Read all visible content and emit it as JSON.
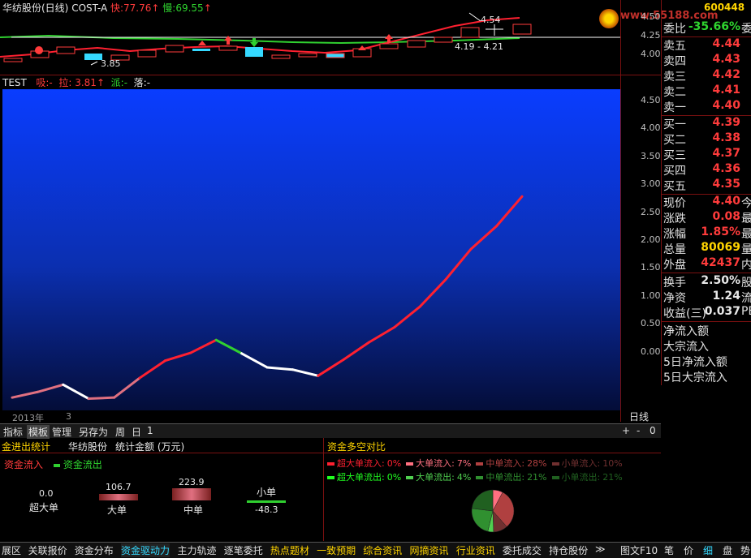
{
  "kline": {
    "stock_name": "华纺股份(日线)",
    "indicator": "COST-A",
    "fast_label": "快:",
    "fast_value": "77.76",
    "slow_label": "慢:",
    "slow_value": "69.55",
    "arrow": "↑",
    "ann_high": "4.54",
    "ann_low": "3.85",
    "ann_range": "4.19 - 4.21",
    "watermark": "www.55188.com",
    "axis_labels": [
      "4.50",
      "4.25",
      "4.00"
    ]
  },
  "test_bar": {
    "name": "TEST",
    "xi_label": "吸:",
    "xi_value": "-",
    "la_label": "拉:",
    "la_value": "3.81",
    "pai_label": "派:",
    "pai_value": "-",
    "luo_label": "落:",
    "luo_value": "-"
  },
  "chart_data": {
    "type": "line",
    "x": [
      0,
      1,
      2,
      3,
      4,
      5,
      6,
      7,
      8,
      9,
      10,
      11,
      12,
      13,
      14,
      15,
      16,
      17,
      18,
      19,
      20
    ],
    "values": [
      -0.82,
      -0.72,
      -0.59,
      -0.84,
      -0.82,
      -0.47,
      -0.16,
      -0.02,
      0.21,
      -0.03,
      -0.28,
      -0.32,
      -0.43,
      -0.14,
      0.17,
      0.44,
      0.81,
      1.29,
      1.84,
      2.25,
      2.78
    ],
    "colors": [
      "#e07080",
      "#e07080",
      "#ffffff",
      "#e07080",
      "#e07080",
      "#ff2030",
      "#ff2030",
      "#ff2030",
      "#30d030",
      "#ffffff",
      "#ffffff",
      "#ffffff",
      "#ff2030",
      "#ff2030",
      "#ff2030",
      "#ff2030",
      "#ff2030",
      "#ff2030",
      "#ff2030",
      "#ff2030"
    ],
    "ylim": [
      -1.05,
      4.7
    ],
    "yticks": [
      "4.50",
      "4.00",
      "3.50",
      "3.00",
      "2.50",
      "2.00",
      "1.50",
      "1.00",
      "0.50",
      "0.00"
    ],
    "xlabels": [
      "2013年",
      "3"
    ],
    "period": "日线"
  },
  "quote": {
    "code": "600448",
    "wei_bi_label": "委比",
    "wei_bi": "-35.66%",
    "wei_bi_ext": "委",
    "sells": [
      {
        "label": "卖五",
        "price": "4.44"
      },
      {
        "label": "卖四",
        "price": "4.43"
      },
      {
        "label": "卖三",
        "price": "4.42"
      },
      {
        "label": "卖二",
        "price": "4.41"
      },
      {
        "label": "卖一",
        "price": "4.40"
      }
    ],
    "buys": [
      {
        "label": "买一",
        "price": "4.39"
      },
      {
        "label": "买二",
        "price": "4.38"
      },
      {
        "label": "买三",
        "price": "4.37"
      },
      {
        "label": "买四",
        "price": "4.36"
      },
      {
        "label": "买五",
        "price": "4.35"
      }
    ],
    "stats": [
      {
        "label": "现价",
        "value": "4.40",
        "ext": "今",
        "color": "#ff3b3b"
      },
      {
        "label": "涨跌",
        "value": "0.08",
        "ext": "最",
        "color": "#ff3b3b"
      },
      {
        "label": "涨幅",
        "value": "1.85%",
        "ext": "最",
        "color": "#ff3b3b"
      },
      {
        "label": "总量",
        "value": "80069",
        "ext": "量",
        "color": "#ffd400"
      },
      {
        "label": "外盘",
        "value": "42437",
        "ext": "内",
        "color": "#ff3b3b"
      }
    ],
    "stats2": [
      {
        "label": "换手",
        "value": "2.50%",
        "ext": "股"
      },
      {
        "label": "净资",
        "value": "1.24",
        "ext": "流"
      },
      {
        "label": "收益(三)",
        "value": "0.037",
        "ext": "PE"
      }
    ],
    "flows": [
      "净流入额",
      "大宗流入",
      "5日净流入额",
      "5日大宗流入"
    ]
  },
  "tabs": [
    "指标",
    "模板",
    "管理",
    "另存为",
    "周",
    "日",
    "1"
  ],
  "zoom": {
    "plus": "+",
    "minus": "-",
    "zero": "0"
  },
  "bottom_left": {
    "title": "金进出统计",
    "stock": "华纺股份",
    "stat_title": "统计金额 (万元)",
    "legend_in": "资金流入",
    "legend_out": "资金流出",
    "bars": [
      {
        "label": "超大单",
        "in": "0.0",
        "out": ""
      },
      {
        "label": "大单",
        "in": "106.7",
        "out": ""
      },
      {
        "label": "中单",
        "in": "223.9",
        "out": ""
      },
      {
        "label": "小单",
        "in": "",
        "out": "-48.3"
      }
    ]
  },
  "bottom_right": {
    "title": "资金多空对比",
    "row1": [
      {
        "label": "超大单流入:",
        "pct": "0%",
        "color": "#ff2030"
      },
      {
        "label": "大单流入:",
        "pct": "7%",
        "color": "#ff7080"
      },
      {
        "label": "中单流入:",
        "pct": "28%",
        "color": "#b04040"
      },
      {
        "label": "小单流入:",
        "pct": "10%",
        "color": "#703030"
      }
    ],
    "row2": [
      {
        "label": "超大单流出:",
        "pct": "0%",
        "color": "#20ff20"
      },
      {
        "label": "大单流出:",
        "pct": "4%",
        "color": "#50d050"
      },
      {
        "label": "中单流出:",
        "pct": "21%",
        "color": "#309030"
      },
      {
        "label": "小单流出:",
        "pct": "21%",
        "color": "#206020"
      }
    ],
    "pie": [
      0,
      7,
      28,
      10,
      0,
      4,
      21,
      21
    ]
  },
  "status_bar": {
    "items": [
      "展区",
      "关联报价",
      "资金分布",
      "资金驱动力",
      "主力轨迹",
      "逐笔委托",
      "热点题材",
      "一致预期",
      "综合资讯",
      "网摘资讯",
      "行业资讯",
      "委托成交",
      "持仓股份"
    ],
    "more": "≫",
    "right_items": [
      "图文F10",
      "笔",
      "价",
      "细",
      "盘",
      "势"
    ]
  }
}
